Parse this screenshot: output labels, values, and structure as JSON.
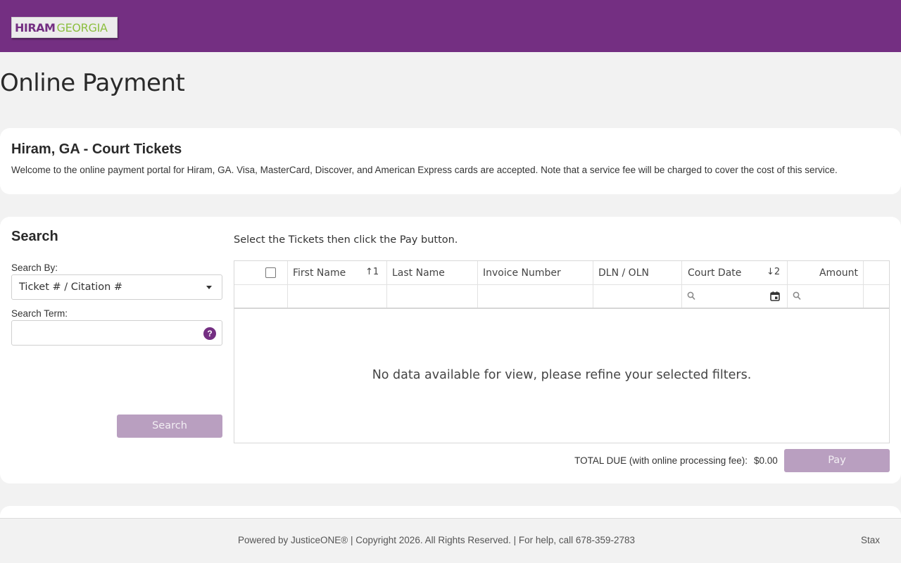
{
  "header": {
    "logo_part1": "HIRAM",
    "logo_part2": "GEORGIA",
    "brand_color": "#742f82"
  },
  "page_title": "Online Payment",
  "intro": {
    "title": "Hiram, GA - Court Tickets",
    "text": "Welcome to the online payment portal for Hiram, GA. Visa, MasterCard, Discover, and American Express cards are accepted. Note that a service fee will be charged to cover the cost of this service."
  },
  "search": {
    "title": "Search",
    "search_by_label": "Search By:",
    "search_by_value": "Ticket # / Citation #",
    "search_term_label": "Search Term:",
    "search_term_value": "",
    "help_icon": "?",
    "button_label": "Search"
  },
  "grid": {
    "instruction": "Select the Tickets then click the Pay button.",
    "columns": [
      {
        "label": "",
        "type": "checkbox"
      },
      {
        "label": "First Name",
        "sort": "↑1"
      },
      {
        "label": "Last Name"
      },
      {
        "label": "Invoice Number"
      },
      {
        "label": "DLN / OLN"
      },
      {
        "label": "Court Date",
        "sort": "↓2"
      },
      {
        "label": "Amount"
      }
    ],
    "empty_message": "No data available for view, please refine your selected filters."
  },
  "payment": {
    "total_label": "TOTAL DUE (with online processing fee):",
    "total_value": "$0.00",
    "pay_label": "Pay"
  },
  "footer": {
    "text": "Powered by JusticeONE® | Copyright 2026. All Rights Reserved. | For help, call 678-359-2783",
    "stax": "Stax"
  }
}
